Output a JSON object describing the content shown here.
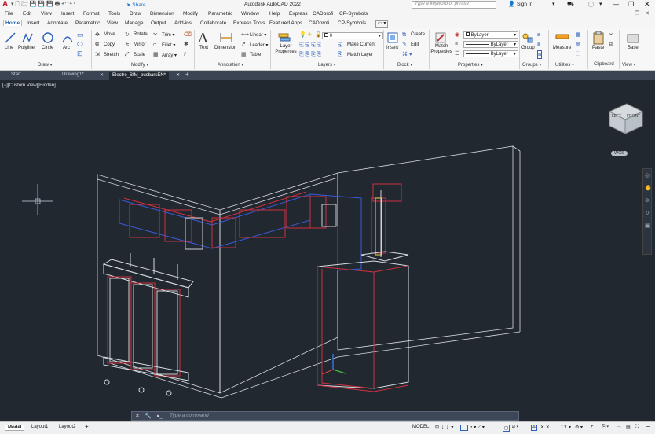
{
  "app": {
    "logo_letter": "A",
    "title": "Autodesk AutoCAD 2022",
    "share_label": "Share",
    "search_placeholder": "Type a keyword or phrase",
    "sign_in": "Sign In"
  },
  "menu": [
    "File",
    "Edit",
    "View",
    "Insert",
    "Format",
    "Tools",
    "Draw",
    "Dimension",
    "Modify",
    "Parametric",
    "Window",
    "Help",
    "Express",
    "CADprofi",
    "CP-Symbols"
  ],
  "ribbon_tabs": [
    "Home",
    "Insert",
    "Annotate",
    "Parametric",
    "View",
    "Manage",
    "Output",
    "Add-ins",
    "Collaborate",
    "Express Tools",
    "Featured Apps",
    "CADprofi",
    "CP-Symbols"
  ],
  "draw": {
    "line": "Line",
    "polyline": "Polyline",
    "circle": "Circle",
    "arc": "Arc",
    "panel": "Draw ▾"
  },
  "modify": {
    "move": "Move",
    "rotate": "Rotate",
    "trim": "Trim ▾",
    "copy": "Copy",
    "mirror": "Mirror",
    "fillet": "Fillet ▾",
    "stretch": "Stretch",
    "scale": "Scale",
    "array": "Array ▾",
    "panel": "Modify ▾"
  },
  "annotation": {
    "text": "Text",
    "dimension": "Dimension",
    "linear": "Linear ▾",
    "leader": "Leader ▾",
    "table": "Table",
    "panel": "Annotation ▾"
  },
  "layers": {
    "layer_properties": "Layer Properties",
    "current_layer": "0",
    "make_current": "Make Current",
    "match_layer": "Match Layer",
    "panel": "Layers ▾"
  },
  "block": {
    "insert": "Insert",
    "create": "Create",
    "edit": "Edit",
    "panel": "Block ▾"
  },
  "properties": {
    "match": "Match Properties",
    "color": "ByLayer",
    "linetype": "ByLayer",
    "lineweight": "ByLayer",
    "panel": "Properties ▾"
  },
  "groups": {
    "group": "Group",
    "panel": "Groups ▾"
  },
  "utilities": {
    "measure": "Measure",
    "panel": "Utilities ▾"
  },
  "clipboard": {
    "paste": "Paste",
    "panel": "Clipboard"
  },
  "view_panel": {
    "base": "Base",
    "panel": "View ▾"
  },
  "file_tabs": [
    "Start",
    "Drawing1*",
    "Electro_BIM_busbarsEN*"
  ],
  "viewport": {
    "label": "[−][Custom View][Hidden]",
    "wcs": "WCS",
    "cube_left": "LEFT",
    "cube_front": "FRONT"
  },
  "command": {
    "placeholder": "Type a command"
  },
  "layouts": [
    "Model",
    "Layout1",
    "Layout2",
    "+"
  ],
  "status": {
    "model": "MODEL",
    "scale": "1:1 ▾"
  }
}
